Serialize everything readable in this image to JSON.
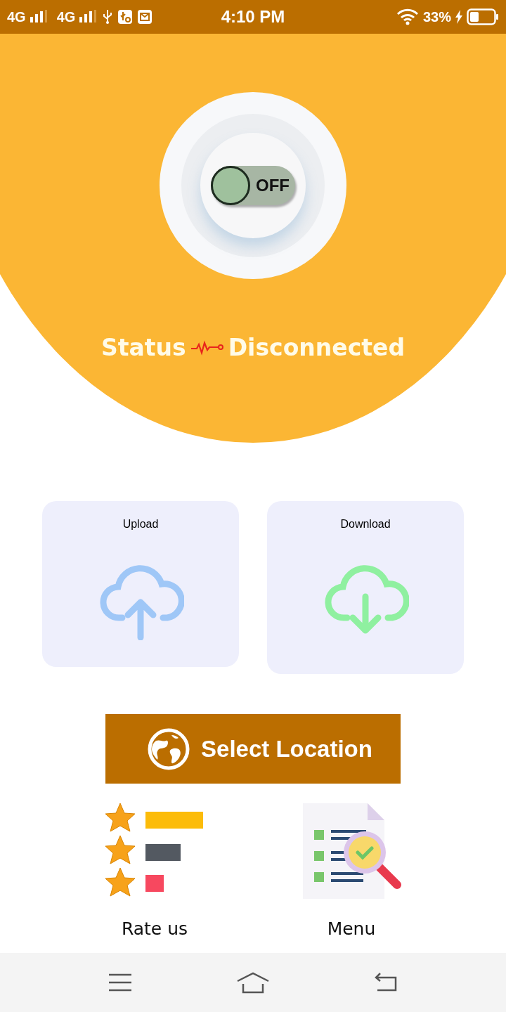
{
  "status_bar": {
    "network_1": "4G",
    "network_2": "4G",
    "time": "4:10 PM",
    "battery": "33%"
  },
  "vpn_toggle": {
    "label": "OFF",
    "on": false
  },
  "status": {
    "label": "Status",
    "value": "Disconnected"
  },
  "cards": [
    {
      "kind": "upload",
      "label": "Upload"
    },
    {
      "kind": "download",
      "label": "Download"
    }
  ],
  "select_location_button": {
    "label": "Select Location"
  },
  "shortcuts": [
    {
      "kind": "rate",
      "label": "Rate us"
    },
    {
      "kind": "menu",
      "label": "Menu"
    }
  ]
}
